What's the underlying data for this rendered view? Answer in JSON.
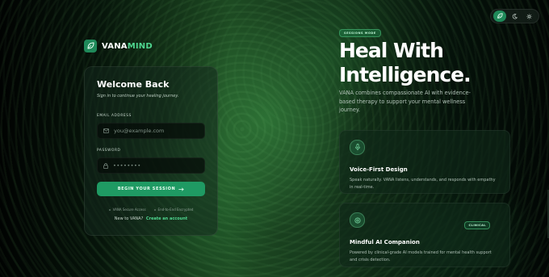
{
  "brand": {
    "name_main": "VANA",
    "name_accent": "MIND",
    "accent_color": "#4fd68f",
    "primary_color": "#1f9a63"
  },
  "theme_toggle": {
    "options": [
      "leaf-icon",
      "moon-icon",
      "sun-icon"
    ],
    "active": "leaf-icon"
  },
  "login": {
    "title": "Welcome Back",
    "subtitle": "Sign in to continue your healing journey.",
    "email_label": "EMAIL ADDRESS",
    "email_placeholder": "you@example.com",
    "password_label": "PASSWORD",
    "password_placeholder": "••••••••",
    "submit_label": "BEGIN YOUR SESSION",
    "badge_secure": "VANA Secure Access",
    "badge_encrypted": "End-to-End Encrypted",
    "new_user_text": "New to VANA?",
    "create_account": "Create an account"
  },
  "hero": {
    "pill": "SESSIONS MODE",
    "headline_line1": "Heal With",
    "headline_line2": "Intelligence.",
    "description": "VANA combines compassionate AI with evidence-based therapy to support your mental wellness journey."
  },
  "features": [
    {
      "icon": "microphone-icon",
      "title": "Voice-First Design",
      "text": "Speak naturally. VANA listens, understands, and responds with empathy in real-time."
    },
    {
      "icon": "brain-icon",
      "title": "Mindful AI Companion",
      "badge": "CLINICAL",
      "text": "Powered by clinical-grade AI models trained for mental health support and crisis detection."
    }
  ]
}
